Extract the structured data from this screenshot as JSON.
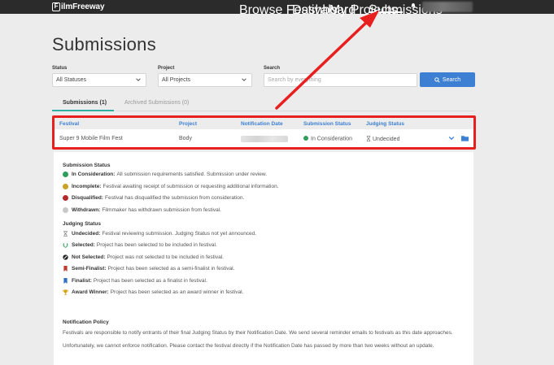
{
  "nav": {
    "logo_text": "ilmFreeway",
    "logo_letter": "F",
    "links": [
      "Browse Festivals",
      "Dashboard",
      "My Projects",
      "Submissions"
    ],
    "active_link": "Submissions"
  },
  "page": {
    "title": "Submissions"
  },
  "filters": {
    "status_label": "Status",
    "status_value": "All Statuses",
    "project_label": "Project",
    "project_value": "All Projects",
    "search_label": "Search",
    "search_placeholder": "Search by everything",
    "search_button": "Search"
  },
  "tabs": [
    {
      "label": "Submissions (1)",
      "active": true
    },
    {
      "label": "Archived Submissions (0)",
      "active": false
    }
  ],
  "table": {
    "headers": [
      "Festival",
      "Project",
      "Notification Date",
      "Submission Status",
      "Judging Status"
    ],
    "rows": [
      {
        "festival": "Super 9 Mobile Film Fest",
        "project": "Body",
        "submission_status": "In Consideration",
        "submission_status_color": "#2e9e5b",
        "judging_status": "Undecided"
      }
    ]
  },
  "legend": {
    "submission_title": "Submission Status",
    "submission_items": [
      {
        "term": "In Consideration:",
        "desc": "All submission requirements satisfied. Submission under review.",
        "color": "#2e9e5b",
        "icon": "green-dot-icon"
      },
      {
        "term": "Incomplete:",
        "desc": "Festival awaiting receipt of submission or requesting additional information.",
        "color": "#c9a227",
        "icon": "yellow-dot-icon"
      },
      {
        "term": "Disqualified:",
        "desc": "Festival has disqualified the submission from consideration.",
        "color": "#b22a2a",
        "icon": "red-dot-icon"
      },
      {
        "term": "Withdrawn:",
        "desc": "Filmmaker has withdrawn submission from festival.",
        "color": "#c8c8c8",
        "icon": "grey-dot-icon"
      }
    ],
    "judging_title": "Judging Status",
    "judging_items": [
      {
        "term": "Undecided:",
        "desc": "Festival reviewing submission. Judging Status not yet announced.",
        "icon": "hourglass-icon"
      },
      {
        "term": "Selected:",
        "desc": "Project has been selected to be included in festival.",
        "icon": "laurel-icon"
      },
      {
        "term": "Not Selected:",
        "desc": "Project was not selected to be included in festival.",
        "icon": "ban-icon"
      },
      {
        "term": "Semi-Finalist:",
        "desc": "Project has been selected as a semi-finalist in festival.",
        "icon": "red-ribbon-icon"
      },
      {
        "term": "Finalist:",
        "desc": "Project has been selected as a finalist in festival.",
        "icon": "blue-ribbon-icon"
      },
      {
        "term": "Award Winner:",
        "desc": "Project has been selected as an award winner in festival.",
        "icon": "trophy-icon"
      }
    ],
    "policy_title": "Notification Policy",
    "policy_lines": [
      "Festivals are responsible to notify entrants of their final Judging Status by their Notification Date. We send several reminder emails to festivals as this date approaches.",
      "Unfortunately, we cannot enforce notification. Please contact the festival directly if the Notification Date has passed by more than two weeks without an update."
    ]
  },
  "colors": {
    "accent_blue": "#3c7fd3",
    "tab_teal": "#2fb0a5",
    "annotation_red": "#e81f1f",
    "nav_bg": "#2b2b2b"
  }
}
